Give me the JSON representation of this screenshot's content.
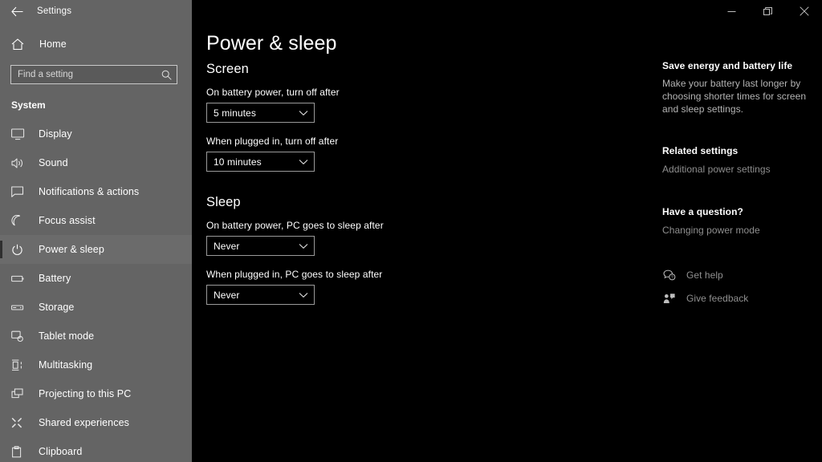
{
  "window": {
    "app_title": "Settings",
    "back_icon": "back-arrow-icon",
    "minimize_icon": "minimize-icon",
    "maximize_icon": "maximize-restore-icon",
    "close_icon": "close-icon"
  },
  "nav": {
    "home_label": "Home",
    "home_icon": "home-icon",
    "search": {
      "placeholder": "Find a setting",
      "value": "",
      "icon": "search-icon"
    },
    "group_title": "System",
    "items": [
      {
        "label": "Display",
        "icon": "monitor-icon",
        "selected": false
      },
      {
        "label": "Sound",
        "icon": "speaker-icon",
        "selected": false
      },
      {
        "label": "Notifications & actions",
        "icon": "notification-icon",
        "selected": false
      },
      {
        "label": "Focus assist",
        "icon": "moon-icon",
        "selected": false
      },
      {
        "label": "Power & sleep",
        "icon": "power-icon",
        "selected": true
      },
      {
        "label": "Battery",
        "icon": "battery-icon",
        "selected": false
      },
      {
        "label": "Storage",
        "icon": "storage-icon",
        "selected": false
      },
      {
        "label": "Tablet mode",
        "icon": "tablet-icon",
        "selected": false
      },
      {
        "label": "Multitasking",
        "icon": "multitasking-icon",
        "selected": false
      },
      {
        "label": "Projecting to this PC",
        "icon": "projecting-icon",
        "selected": false
      },
      {
        "label": "Shared experiences",
        "icon": "shared-icon",
        "selected": false
      },
      {
        "label": "Clipboard",
        "icon": "clipboard-icon",
        "selected": false
      }
    ]
  },
  "main": {
    "page_title": "Power & sleep",
    "sections": [
      {
        "heading": "Screen",
        "fields": [
          {
            "label": "On battery power, turn off after",
            "value": "5 minutes"
          },
          {
            "label": "When plugged in, turn off after",
            "value": "10 minutes"
          }
        ]
      },
      {
        "heading": "Sleep",
        "fields": [
          {
            "label": "On battery power, PC goes to sleep after",
            "value": "Never"
          },
          {
            "label": "When plugged in, PC goes to sleep after",
            "value": "Never"
          }
        ]
      }
    ]
  },
  "aside": {
    "tip_heading": "Save energy and battery life",
    "tip_body": "Make your battery last longer by choosing shorter times for screen and sleep settings.",
    "related_heading": "Related settings",
    "related_link": "Additional power settings",
    "question_heading": "Have a question?",
    "question_link": "Changing power mode",
    "support": [
      {
        "label": "Get help",
        "icon": "get-help-icon"
      },
      {
        "label": "Give feedback",
        "icon": "give-feedback-icon"
      }
    ]
  },
  "colors": {
    "nav_background": "#646464",
    "content_background": "#000000",
    "nav_selected": "#6b6b6b",
    "text_primary": "#ffffff",
    "text_secondary": "#b4b4b4",
    "link_muted": "#8f8f8f",
    "control_border": "#9a9a9a"
  }
}
